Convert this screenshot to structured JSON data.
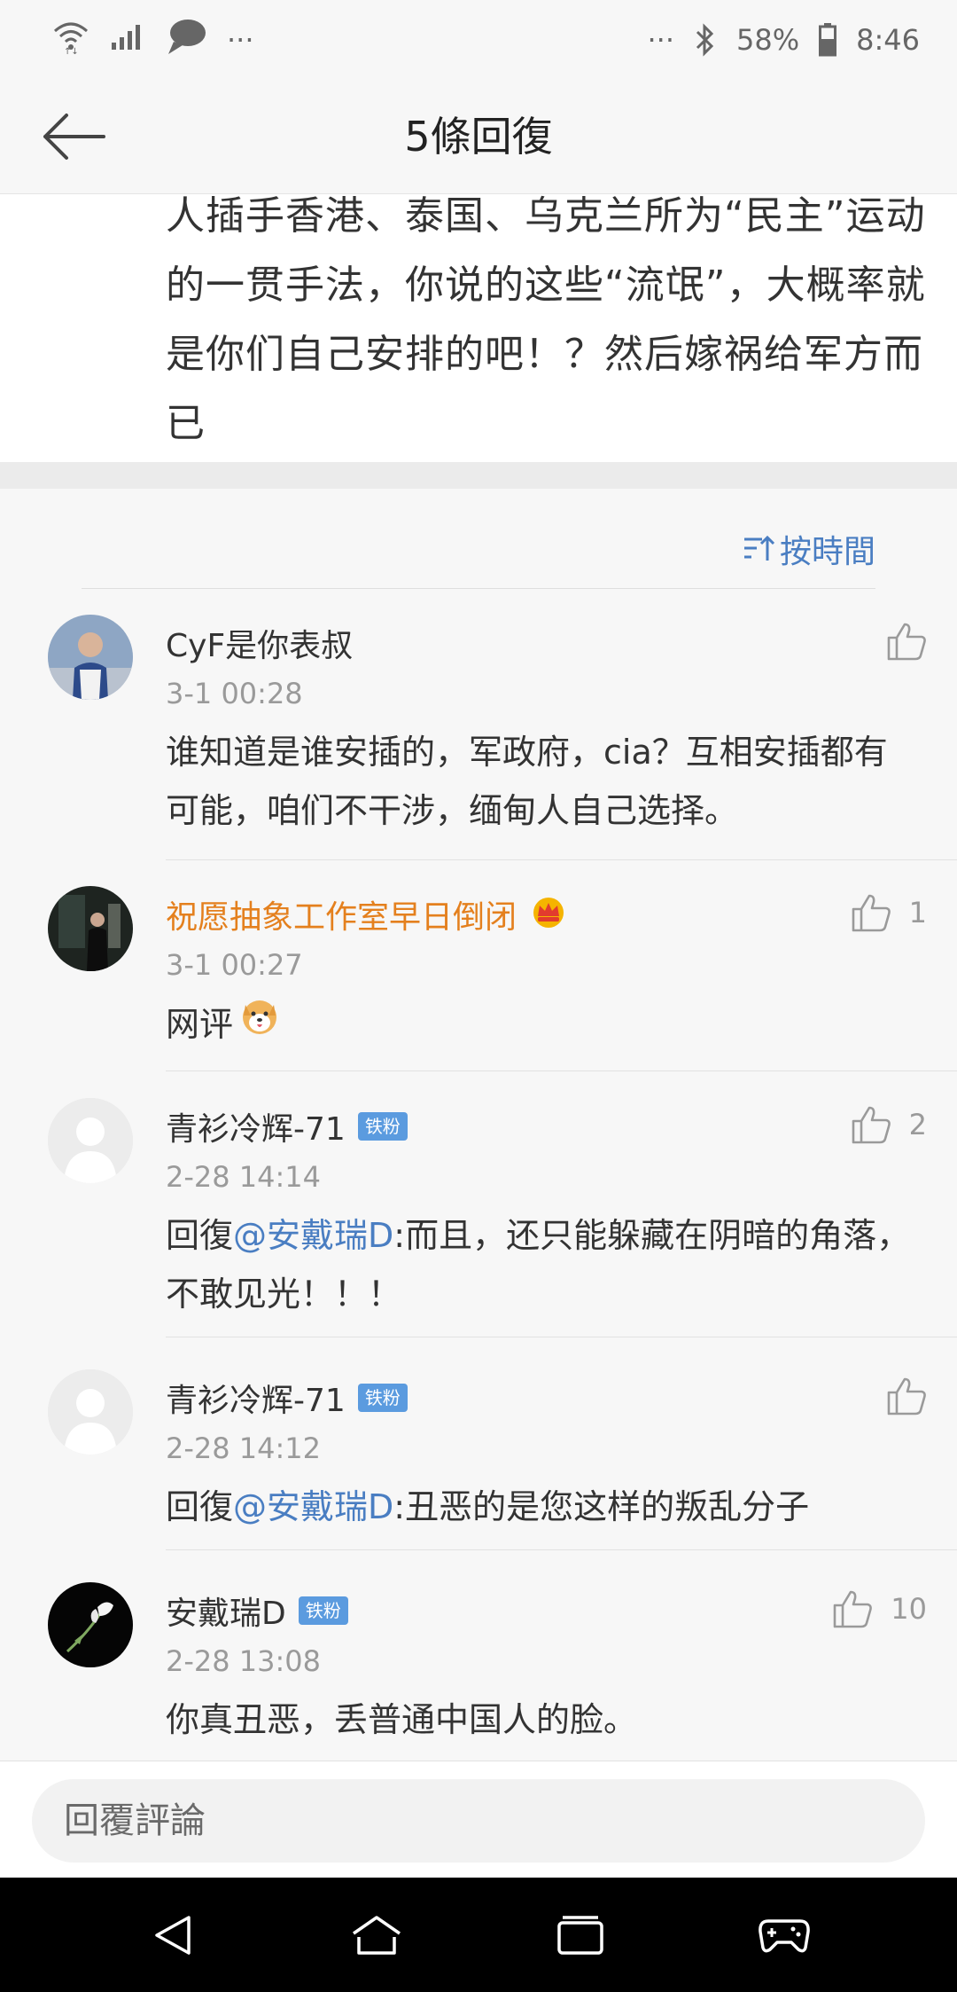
{
  "status_bar": {
    "left_dots": "···",
    "right_dots": "···",
    "battery": "58%",
    "time": "8:46"
  },
  "header": {
    "title": "5條回復"
  },
  "original_post": {
    "text": "人插手香港、泰国、乌克兰所为“民主”运动的一贯手法，你说的这些“流氓”，大概率就是你们自己安排的吧！？然后嫁祸给军方而已"
  },
  "sort": {
    "label": "按時間"
  },
  "comments": [
    {
      "name": "CyF是你表叔",
      "time": "3-1 00:28",
      "text": "谁知道是谁安插的，军政府，cia？互相安插都有可能，咱们不干涉，缅甸人自己选择。",
      "likes": ""
    },
    {
      "name": "祝愿抽象工作室早日倒闭",
      "time": "3-1 00:27",
      "text": "网评",
      "likes": "1",
      "name_color": "#e4801e"
    },
    {
      "name": "青衫冷辉-71",
      "badge": "铁粉",
      "time": "2-28 14:14",
      "reply_prefix": "回復",
      "mention": "@安戴瑞D",
      "text": ":而且，还只能躲藏在阴暗的角落，不敢见光！！！",
      "likes": "2"
    },
    {
      "name": "青衫冷辉-71",
      "badge": "铁粉",
      "time": "2-28 14:12",
      "reply_prefix": "回復",
      "mention": "@安戴瑞D",
      "text": ":丑恶的是您这样的叛乱分子",
      "likes": ""
    },
    {
      "name": "安戴瑞D",
      "badge": "铁粉",
      "time": "2-28 13:08",
      "text": "你真丑恶，丢普通中国人的脸。",
      "likes": "10"
    }
  ],
  "reply": {
    "placeholder": "回覆評論"
  },
  "colors": {
    "accent": "#4a7ec2",
    "badge": "#5b9bdf",
    "orange_name": "#e4801e"
  }
}
